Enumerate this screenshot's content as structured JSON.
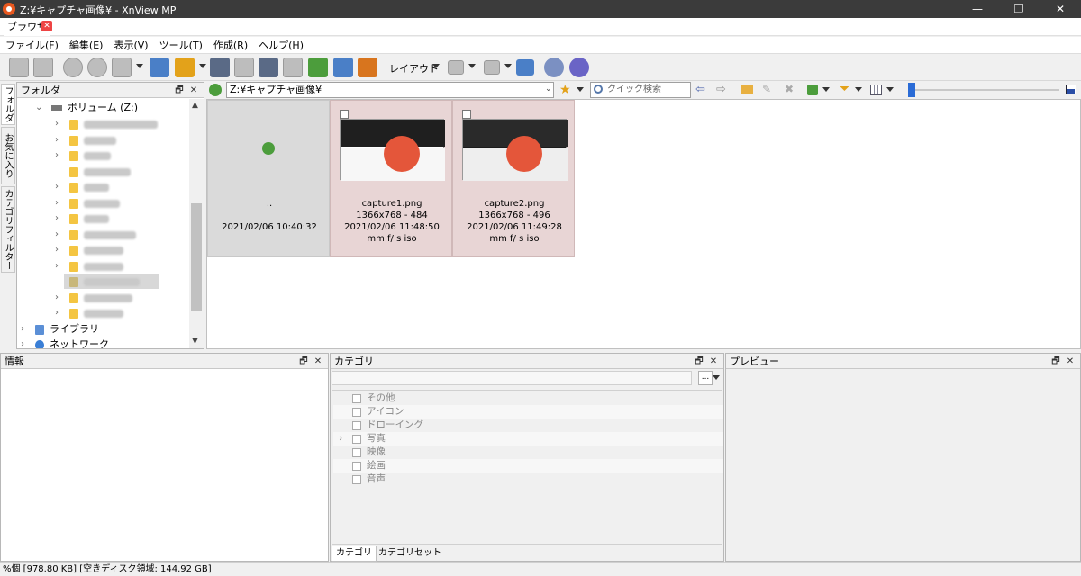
{
  "window": {
    "title": "Z:¥キャプチャ画像¥ - XnView MP",
    "minimize": "—",
    "maximize": "❐",
    "close": "✕"
  },
  "tabs": [
    {
      "label": "ブラウザ",
      "close": "✕"
    }
  ],
  "menu": [
    "ファイル(F)",
    "編集(E)",
    "表示(V)",
    "ツール(T)",
    "作成(R)",
    "ヘルプ(H)"
  ],
  "toolbar": {
    "layout_label": "レイアウト"
  },
  "folders_panel": {
    "title": "フォルダ",
    "float": "🗗",
    "close": "✕",
    "volume": "ボリューム (Z:)",
    "libraries": "ライブラリ",
    "network": "ネットワーク"
  },
  "side_tabs": [
    "フォルダ",
    "お気に入り",
    "カテゴリフィルター"
  ],
  "address": {
    "path": "Z:¥キャプチャ画像¥",
    "search_placeholder": "クイック検索"
  },
  "thumbnails": [
    {
      "name": "..",
      "dims": "",
      "date": "2021/02/06 10:40:32",
      "exif": ""
    },
    {
      "name": "capture1.png",
      "dims": "1366x768 - 484",
      "date": "2021/02/06 11:48:50",
      "exif": "mm f/ s iso"
    },
    {
      "name": "capture2.png",
      "dims": "1366x768 - 496",
      "date": "2021/02/06 11:49:28",
      "exif": "mm f/ s iso"
    }
  ],
  "info_panel": {
    "title": "情報"
  },
  "category_panel": {
    "title": "カテゴリ",
    "dropdown_button": "...",
    "items": [
      "その他",
      "アイコン",
      "ドローイング",
      "写真",
      "映像",
      "絵画",
      "音声"
    ],
    "tabs": [
      "カテゴリ",
      "カテゴリセット"
    ]
  },
  "preview_panel": {
    "title": "プレビュー"
  },
  "status": "%個 [978.80 KB] [空きディスク領域: 144.92 GB]"
}
